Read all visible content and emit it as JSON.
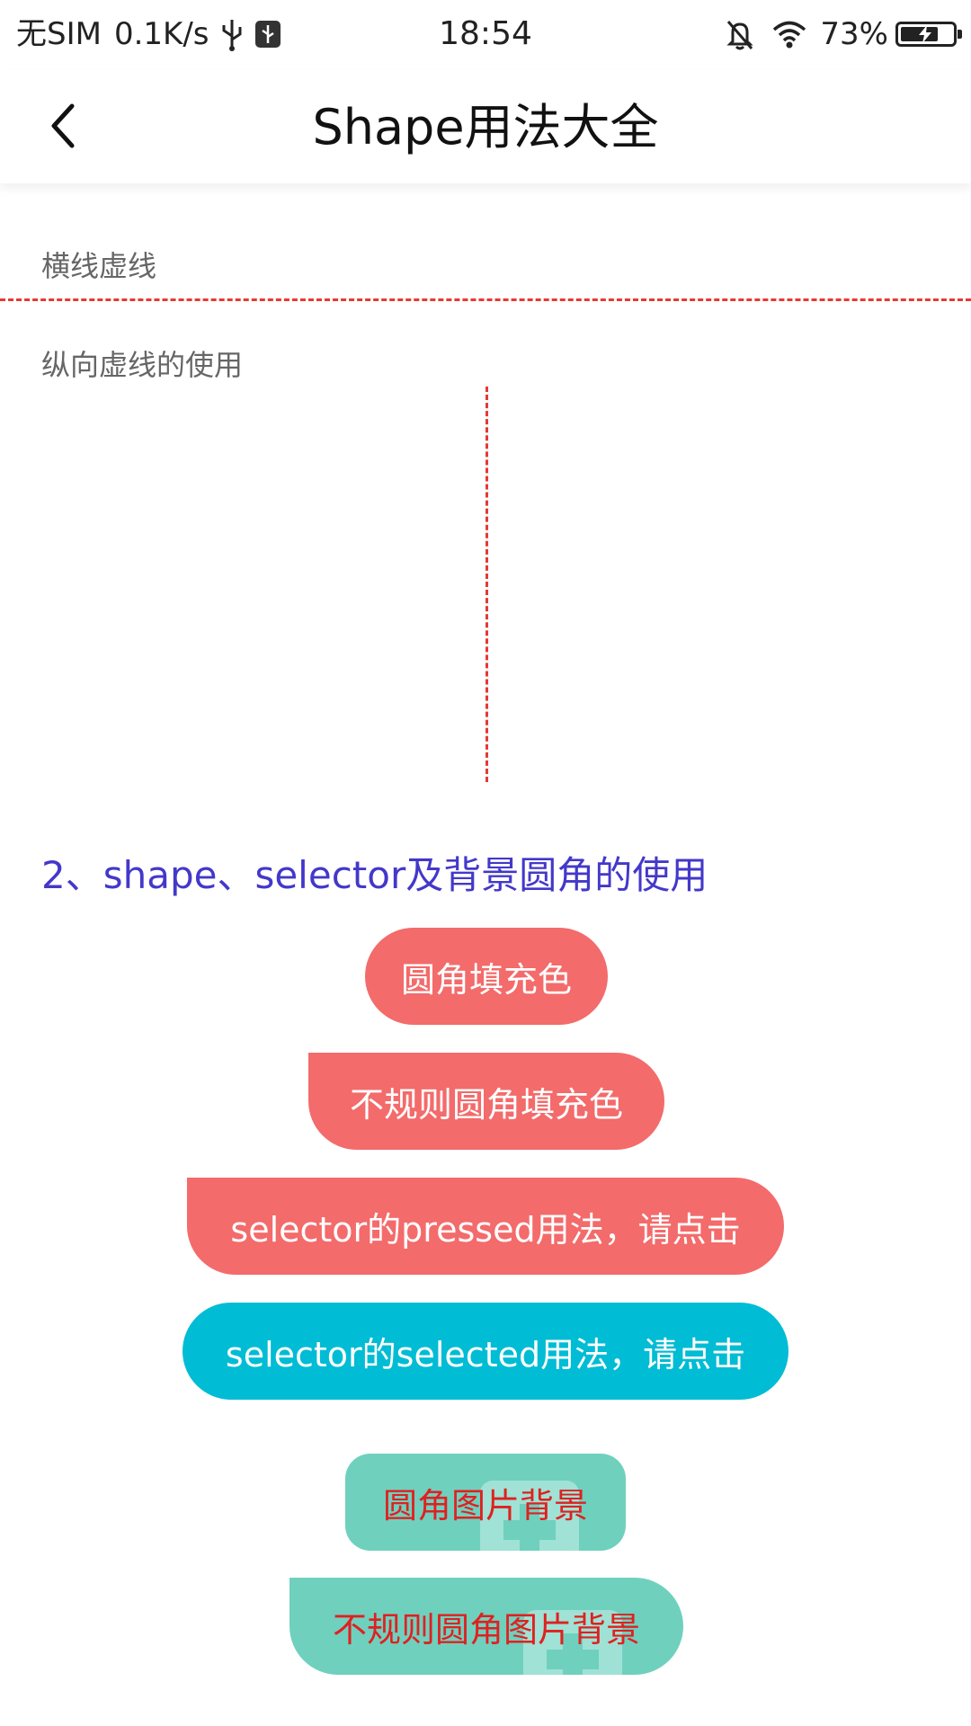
{
  "status_bar": {
    "carrier": "无SIM",
    "net_speed": "0.1K/s",
    "time": "18:54",
    "battery_percent": "73%",
    "battery_level": 0.73,
    "icons": [
      "usb-icon",
      "usb-debug-icon",
      "mute-bell-icon",
      "wifi-icon",
      "battery-charging-icon"
    ]
  },
  "header": {
    "title": "Shape用法大全",
    "back_icon": "chevron-left-icon"
  },
  "content": {
    "horizontal_dash_label": "横线虚线",
    "vertical_dash_label": "纵向虚线的使用",
    "dash_color": "#e53935",
    "section2_title": "2、shape、selector及背景圆角的使用",
    "section2_color": "#4338ca",
    "buttons": {
      "rounded_fill": "圆角填充色",
      "irregular_fill": "不规则圆角填充色",
      "pressed": "selector的pressed用法，请点击",
      "selected": "selector的selected用法，请点击",
      "rounded_image": "圆角图片背景",
      "irregular_image": "不规则圆角图片背景"
    },
    "colors": {
      "fill_red": "#f36b6b",
      "selected_cyan": "#00bcd4",
      "image_teal": "#6fd0be",
      "image_text_red": "#e02020"
    }
  }
}
